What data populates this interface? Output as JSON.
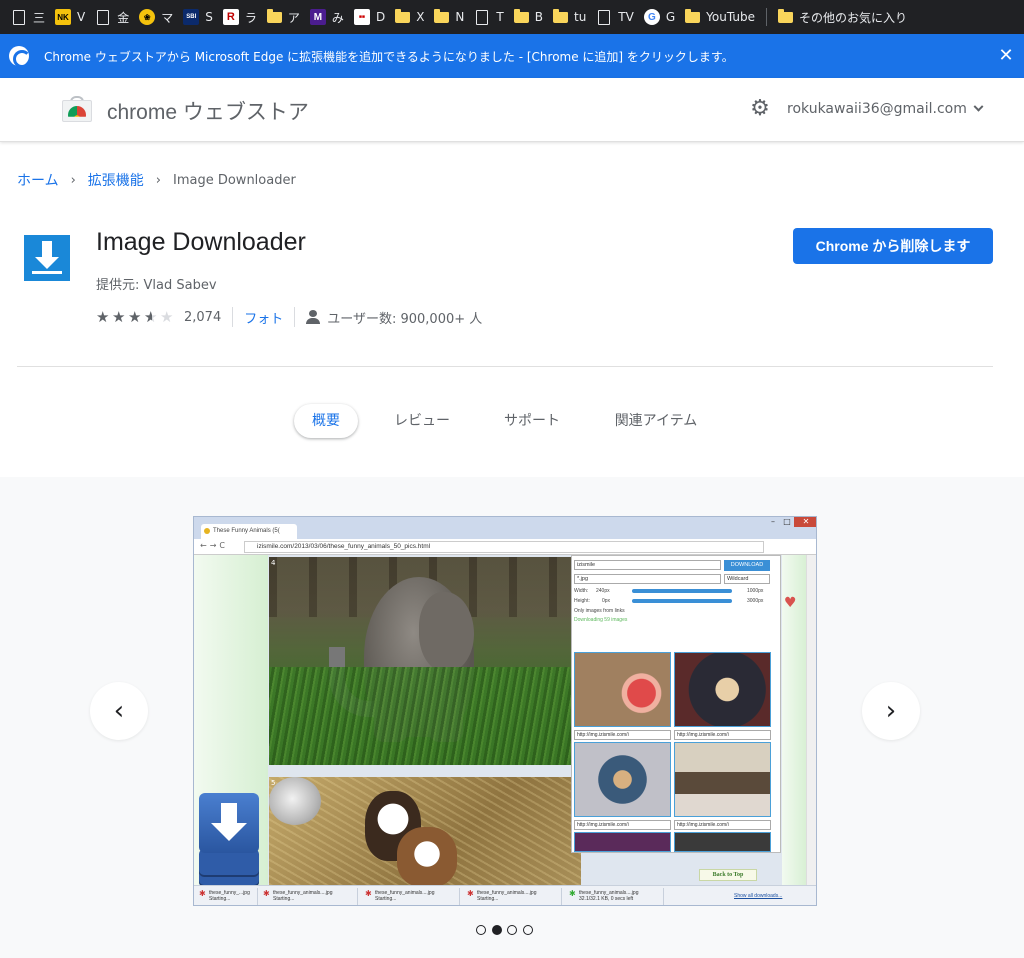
{
  "bookmarks": [
    {
      "icon": "page",
      "label": "三"
    },
    {
      "icon": "nikkei",
      "label": "V"
    },
    {
      "icon": "page",
      "label": "金"
    },
    {
      "icon": "emblem",
      "label": "マ"
    },
    {
      "icon": "sbi",
      "label": "S"
    },
    {
      "icon": "rakuten",
      "label": "ラ"
    },
    {
      "icon": "folder",
      "label": "ア"
    },
    {
      "icon": "m-logo",
      "label": "み"
    },
    {
      "icon": "news",
      "label": "D"
    },
    {
      "icon": "folder",
      "label": "X"
    },
    {
      "icon": "folder",
      "label": "N"
    },
    {
      "icon": "page",
      "label": "T"
    },
    {
      "icon": "folder",
      "label": "B"
    },
    {
      "icon": "folder",
      "label": "tu"
    },
    {
      "icon": "page",
      "label": "TV"
    },
    {
      "icon": "google",
      "label": "G"
    },
    {
      "icon": "folder",
      "label": "YouTube"
    }
  ],
  "bookmarks_other": "その他のお気に入り",
  "banner": {
    "text": "Chrome ウェブストアから Microsoft Edge に拡張機能を追加できるようになりました - [Chrome に追加] をクリックします。"
  },
  "store": {
    "title": "chrome ウェブストア",
    "account": "rokukawaii36@gmail.com"
  },
  "breadcrumb": {
    "home": "ホーム",
    "extensions": "拡張機能",
    "current": "Image Downloader"
  },
  "extension": {
    "name": "Image Downloader",
    "provider": "提供元: Vlad Sabev",
    "rating": 3.5,
    "rating_count": "2,074",
    "category": "フォト",
    "users": "ユーザー数: 900,000+ 人",
    "remove_label": "Chrome から削除します"
  },
  "tabs": [
    {
      "label": "概要",
      "active": true
    },
    {
      "label": "レビュー",
      "active": false
    },
    {
      "label": "サポート",
      "active": false
    },
    {
      "label": "関連アイテム",
      "active": false
    }
  ],
  "gallery": {
    "prev": "‹",
    "next": "›",
    "dots": 4,
    "active_dot": 1,
    "screenshot": {
      "tab_title": "These Funny Animals (5(",
      "url": "izismile.com/2013/03/06/these_funny_animals_50_pics.html",
      "panel": {
        "filter_value": "izismile",
        "ext_value": "*.jpg",
        "match_mode": "Wildcard",
        "download_label": "DOWNLOAD",
        "width_label": "Width:",
        "width_min": "240px",
        "width_max": "1000px",
        "height_label": "Height:",
        "height_min": "0px",
        "height_max": "3000px",
        "only_links_label": "Only images from links",
        "status": "Downloading 59 images",
        "thumb_url": "http://img.izismile.com/i"
      },
      "back_to_top": "Back to Top",
      "show_all_downloads": "Show all downloads...",
      "downloads": [
        {
          "name": "these_funny_...jpg",
          "status": "Starting...",
          "done": false
        },
        {
          "name": "these_funny_animals....jpg",
          "status": "Starting...",
          "done": false
        },
        {
          "name": "these_funny_animals....jpg",
          "status": "Starting...",
          "done": false
        },
        {
          "name": "these_funny_animals....jpg",
          "status": "Starting...",
          "done": false
        },
        {
          "name": "these_funny_animals....jpg",
          "status": "32.1/32.1 KB, 0 secs left",
          "done": true
        }
      ],
      "image_index_1": "4",
      "image_index_2": "5"
    }
  },
  "colors": {
    "accent": "#1a73e8",
    "bookmarks_bg": "#202124",
    "text": "#202124",
    "muted": "#5f6368",
    "gallery_bg": "#f8f9fa"
  }
}
